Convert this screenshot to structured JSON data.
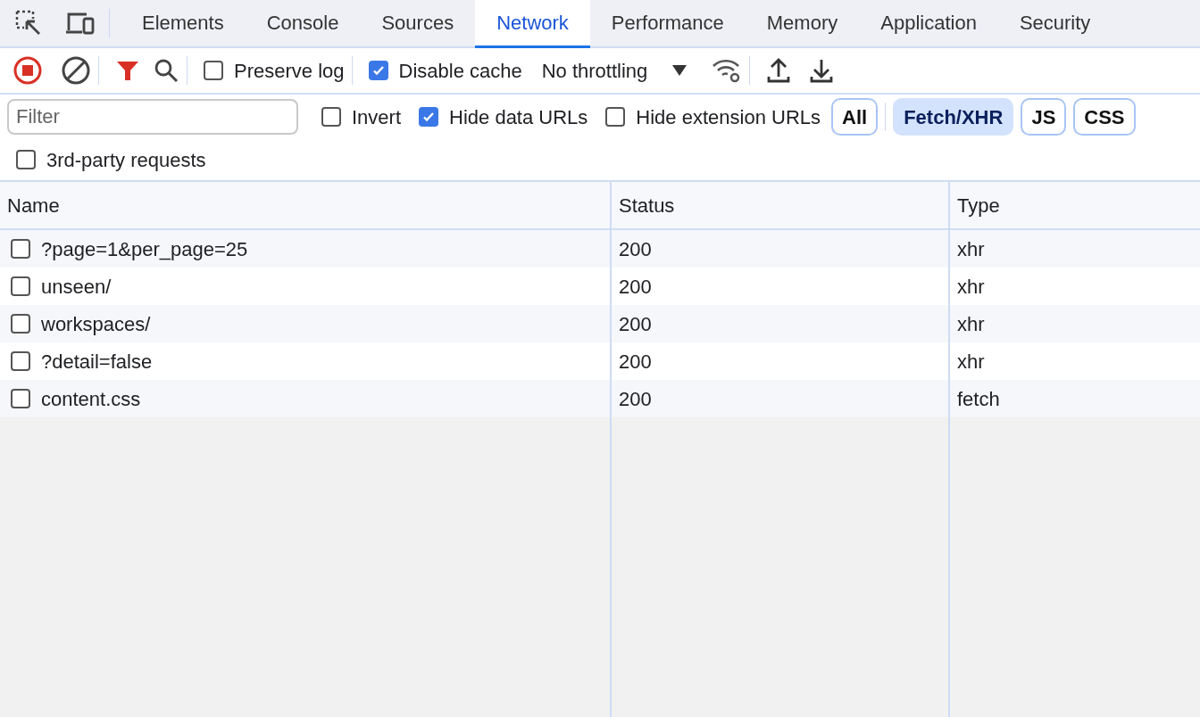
{
  "tabs": [
    {
      "label": "Elements",
      "selected": false
    },
    {
      "label": "Console",
      "selected": false
    },
    {
      "label": "Sources",
      "selected": false
    },
    {
      "label": "Network",
      "selected": true
    },
    {
      "label": "Performance",
      "selected": false
    },
    {
      "label": "Memory",
      "selected": false
    },
    {
      "label": "Application",
      "selected": false
    },
    {
      "label": "Security",
      "selected": false
    }
  ],
  "toolbar": {
    "recording": true,
    "preserve_log": {
      "label": "Preserve log",
      "checked": false
    },
    "disable_cache": {
      "label": "Disable cache",
      "checked": true
    },
    "throttling": "No throttling"
  },
  "filter": {
    "placeholder": "Filter",
    "options": [
      {
        "label": "Invert",
        "checked": false
      },
      {
        "label": "Hide data URLs",
        "checked": true
      },
      {
        "label": "Hide extension URLs",
        "checked": false
      }
    ],
    "types": [
      {
        "label": "All",
        "selected": false
      },
      {
        "label": "Fetch/XHR",
        "selected": true
      },
      {
        "label": "JS",
        "selected": false
      },
      {
        "label": "CSS",
        "selected": false
      }
    ],
    "third_party": {
      "label": "3rd-party requests",
      "checked": false
    }
  },
  "table": {
    "columns": [
      "Name",
      "Status",
      "Type"
    ],
    "rows": [
      {
        "name": "?page=1&per_page=25",
        "status": "200",
        "type": "xhr",
        "checked": false
      },
      {
        "name": "unseen/",
        "status": "200",
        "type": "xhr",
        "checked": false
      },
      {
        "name": "workspaces/",
        "status": "200",
        "type": "xhr",
        "checked": false
      },
      {
        "name": "?detail=false",
        "status": "200",
        "type": "xhr",
        "checked": false
      },
      {
        "name": "content.css",
        "status": "200",
        "type": "fetch",
        "checked": false
      }
    ]
  }
}
